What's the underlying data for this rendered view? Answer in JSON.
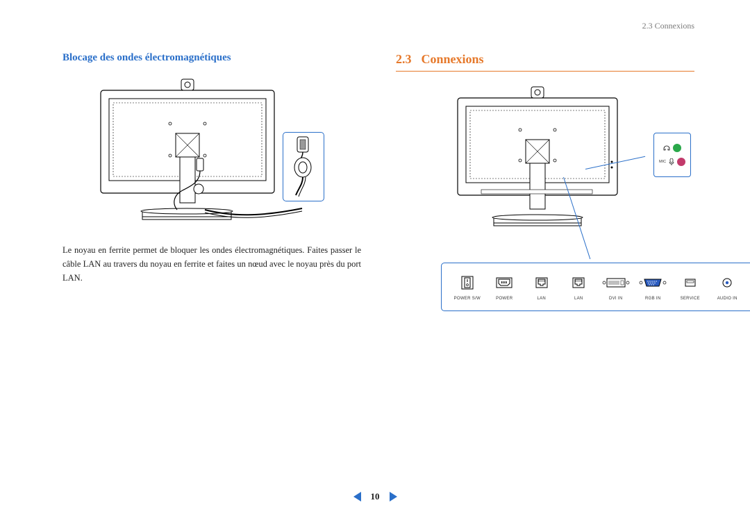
{
  "header": {
    "running_head": "2.3 Connexions"
  },
  "left": {
    "subhead": "Blocage des ondes électromagnétiques",
    "body": "Le noyau en ferrite permet de bloquer les ondes électromagnétiques. Faites passer le câble LAN au travers du noyau en ferrite et faites un nœud avec le noyau près du port LAN."
  },
  "right": {
    "section_number": "2.3",
    "section_title": "Connexions",
    "mic_label": "MIC",
    "ports": [
      {
        "label": "POWER S/W"
      },
      {
        "label": "POWER"
      },
      {
        "label": "LAN"
      },
      {
        "label": "LAN"
      },
      {
        "label": "DVI IN"
      },
      {
        "label": "RGB IN"
      },
      {
        "label": "SERVICE"
      },
      {
        "label": "AUDIO IN"
      }
    ]
  },
  "pager": {
    "page": "10"
  }
}
